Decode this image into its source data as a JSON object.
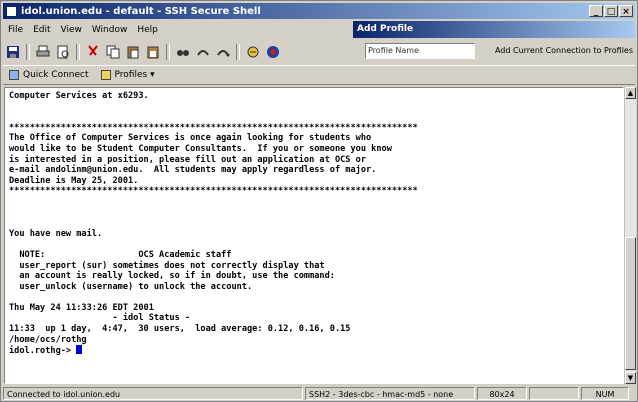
{
  "window": {
    "title": "idol.union.edu - default - SSH Secure Shell",
    "controls": [
      "_",
      "□",
      "×"
    ]
  },
  "menu": [
    "File",
    "Edit",
    "View",
    "Window",
    "Help"
  ],
  "add_profile": {
    "header": "Add Profile",
    "placeholder": "Profile Name",
    "button": "Add Current Connection to Profiles"
  },
  "toolbar_icons": [
    "save-icon",
    "print-icon",
    "print-preview-icon",
    "cut-icon",
    "copy-icon",
    "paste-icon",
    "paste-special-icon",
    "find-icon",
    "settings-icon",
    "key-icon",
    "file-transfer-icon",
    "help-icon"
  ],
  "quickbar": {
    "quick_connect": "Quick Connect",
    "profiles": "Profiles ▾"
  },
  "terminal": {
    "lines": "Computer Services at x6293.\n\n\n*******************************************************************************\nThe Office of Computer Services is once again looking for students who\nwould like to be Student Computer Consultants.  If you or someone you know\nis interested in a position, please fill out an application at OCS or\ne-mail andolinm@union.edu.  All students may apply regardless of major.\nDeadline is May 25, 2001.\n*******************************************************************************\n\n\n\nYou have new mail.\n\n  NOTE:                  OCS Academic staff\n  user_report (sur) sometimes does not correctly display that\n  an account is really locked, so if in doubt, use the command:\n  user_unlock (username) to unlock the account.\n\nThu May 24 11:33:26 EDT 2001\n                    - idol Status -\n11:33  up 1 day,  4:47,  30 users,  load average: 0.12, 0.16, 0.15\n/home/ocs/rothg",
    "prompt": "idol.rothg-> "
  },
  "status": {
    "connection": "Connected to idol.union.edu",
    "cipher": "SSH2 - 3des-cbc - hmac-md5 - none",
    "size": "80x24",
    "num": "NUM"
  }
}
